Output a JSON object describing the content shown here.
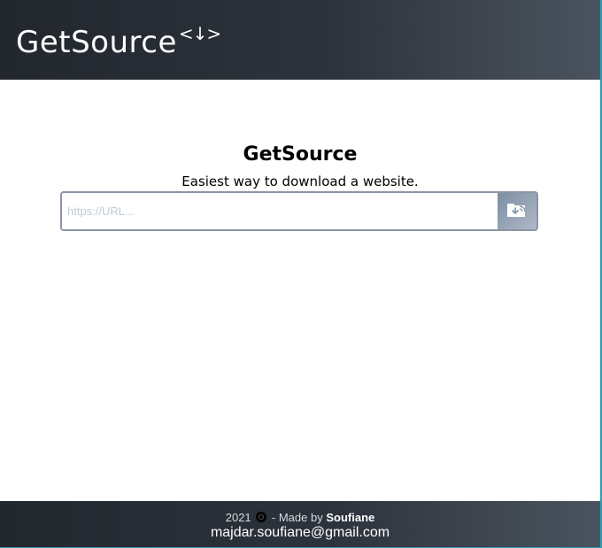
{
  "header": {
    "brand_name": "GetSource",
    "brand_mark": "<↓>"
  },
  "main": {
    "title": "GetSource",
    "subtitle": "Easiest way to download a website.",
    "url_input": {
      "value": "",
      "placeholder": "https://URL..."
    },
    "download_button_icon": "folder-download-icon"
  },
  "footer": {
    "year": "2021",
    "made_by_prefix": "- Made by",
    "author": "Soufiane",
    "email": "majdar.soufiane@gmail.com"
  },
  "colors": {
    "header_bg": "#2d333c",
    "button_bg": "#8f9fb2",
    "frame_accent": "#2b9fb0"
  }
}
